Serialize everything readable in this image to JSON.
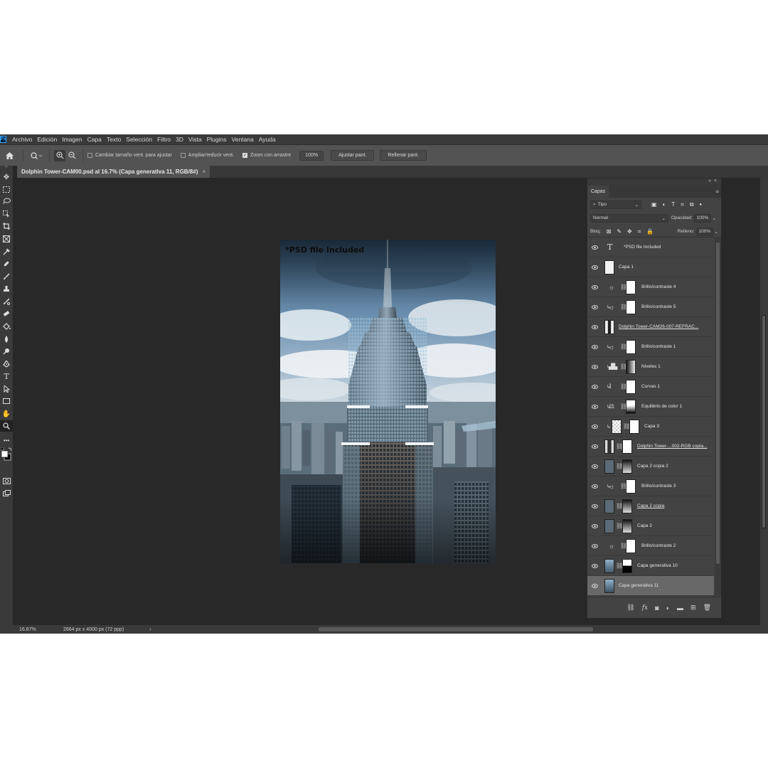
{
  "app": {
    "logo": "Ps"
  },
  "menu": [
    "Archivo",
    "Edición",
    "Imagen",
    "Capa",
    "Texto",
    "Selección",
    "Filtro",
    "3D",
    "Vista",
    "Plugins",
    "Ventana",
    "Ayuda"
  ],
  "options": {
    "resize_windows_label": "Cambiar tamaño vent. para ajustar",
    "zoom_all_label": "Ampliar/reducir vent.",
    "scrubby_zoom_label": "Zoom con arrastre",
    "zoom_value": "100%",
    "fit_screen_label": "Ajustar pant.",
    "fill_screen_label": "Rellenar pant."
  },
  "document": {
    "tab_title": "Dolphin Tower-CAM00.psd al 16.7% (Capa generativa 11, RGB/8#)",
    "close_symbol": "×",
    "overlay_text": "*PSD file Included"
  },
  "status": {
    "zoom": "16.67%",
    "dimensions": "2664 px x 4000 px (72 ppp)",
    "arrow": "›"
  },
  "layers_panel": {
    "tab": "Capas",
    "filter_kind": "Tipo",
    "blend_mode": "Normal",
    "opacity_label": "Opacidad:",
    "opacity_value": "100%",
    "lock_label": "Bloq.:",
    "fill_label": "Relleno:",
    "fill_value": "100%",
    "layers": [
      {
        "name": "*PSD file Included",
        "type": "text",
        "clip": false,
        "selected": false
      },
      {
        "name": "Capa 1",
        "type": "pixel-white",
        "clip": false,
        "selected": false
      },
      {
        "name": "Brillo/contraste 4",
        "type": "brightness",
        "clip": false,
        "selected": false
      },
      {
        "name": "Brillo/contraste 5",
        "type": "brightness",
        "clip": true,
        "selected": false
      },
      {
        "name": "Dolphin Tower-CAM26-007-REFRAC...",
        "type": "building",
        "clip": false,
        "selected": false
      },
      {
        "name": "Brillo/contraste 1",
        "type": "brightness",
        "clip": true,
        "selected": false
      },
      {
        "name": "Niveles 1",
        "type": "levels",
        "clip": true,
        "selected": false
      },
      {
        "name": "Curvas 1",
        "type": "curves",
        "clip": true,
        "selected": false
      },
      {
        "name": "Equilibrio de color 1",
        "type": "colorbalance",
        "clip": true,
        "selected": false
      },
      {
        "name": "Capa 3",
        "type": "checker",
        "clip": true,
        "selected": false
      },
      {
        "name": "Dolphin Tower-...002-RGB copia...",
        "type": "building-mask",
        "clip": false,
        "selected": false
      },
      {
        "name": "Capa 2 copia 2",
        "type": "grey-mask",
        "clip": false,
        "selected": false
      },
      {
        "name": "Brillo/contraste 3",
        "type": "brightness",
        "clip": true,
        "selected": false
      },
      {
        "name": "Capa 2 copia",
        "type": "grey-mask",
        "clip": false,
        "selected": false
      },
      {
        "name": "Capa 2",
        "type": "grey-mask",
        "clip": false,
        "selected": false
      },
      {
        "name": "Brillo/contraste 2",
        "type": "brightness",
        "clip": false,
        "selected": false
      },
      {
        "name": "Capa generativa 10",
        "type": "photo-mask",
        "clip": false,
        "selected": false
      },
      {
        "name": "Capa generativa 11",
        "type": "photo",
        "clip": false,
        "selected": true
      }
    ]
  }
}
